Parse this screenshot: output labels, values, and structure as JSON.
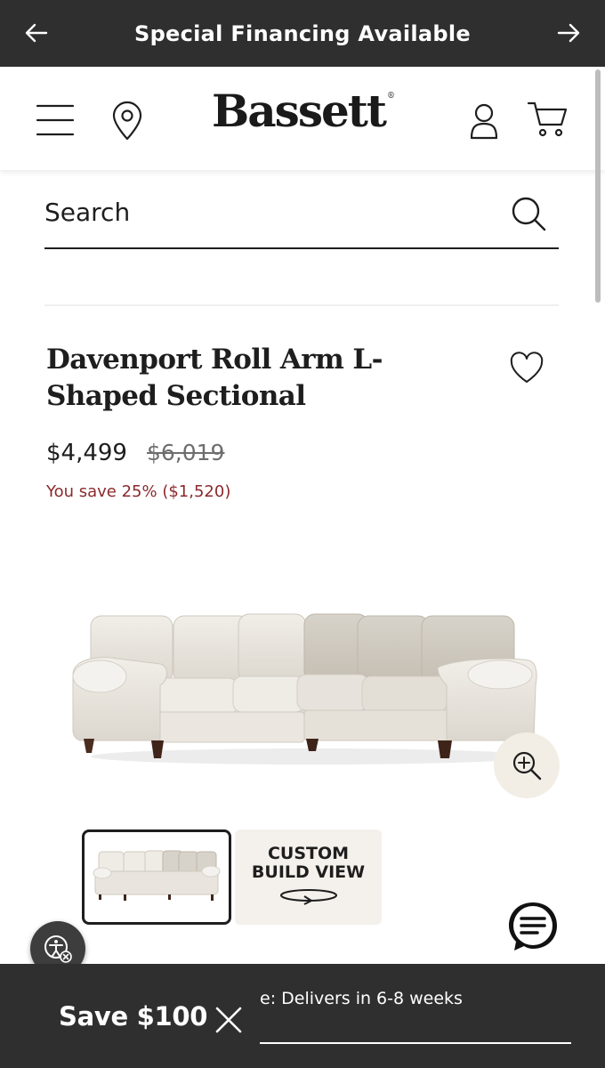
{
  "promo": {
    "text": "Special Financing Available",
    "prev_icon": "arrow-left-icon",
    "next_icon": "arrow-right-icon"
  },
  "header": {
    "logo": "Bassett",
    "logo_mark": "®",
    "icons": [
      "menu-icon",
      "location-pin-icon",
      "account-icon",
      "cart-icon"
    ]
  },
  "search": {
    "placeholder": "Search",
    "icon": "search-icon"
  },
  "product": {
    "title": "Davenport Roll Arm L-Shaped Sectional",
    "price": "$4,499",
    "original_price": "$6,019",
    "savings": "You save 25% ($1,520)",
    "wishlist_icon": "heart-icon"
  },
  "gallery": {
    "zoom_icon": "zoom-in-icon",
    "custom_build_label_1": "CUSTOM",
    "custom_build_label_2": "BUILD VIEW"
  },
  "bottom_bar": {
    "save_label": "Save $100",
    "close_icon": "close-icon",
    "delivery_text": "e: Delivers in 6-8 weeks"
  },
  "floating": {
    "accessibility_icon": "accessibility-icon",
    "chat_icon": "chat-icon"
  },
  "colors": {
    "banner_bg": "#2f2f2f",
    "savings_text": "#8a2a2e",
    "zoom_bg": "#f2eee6"
  }
}
